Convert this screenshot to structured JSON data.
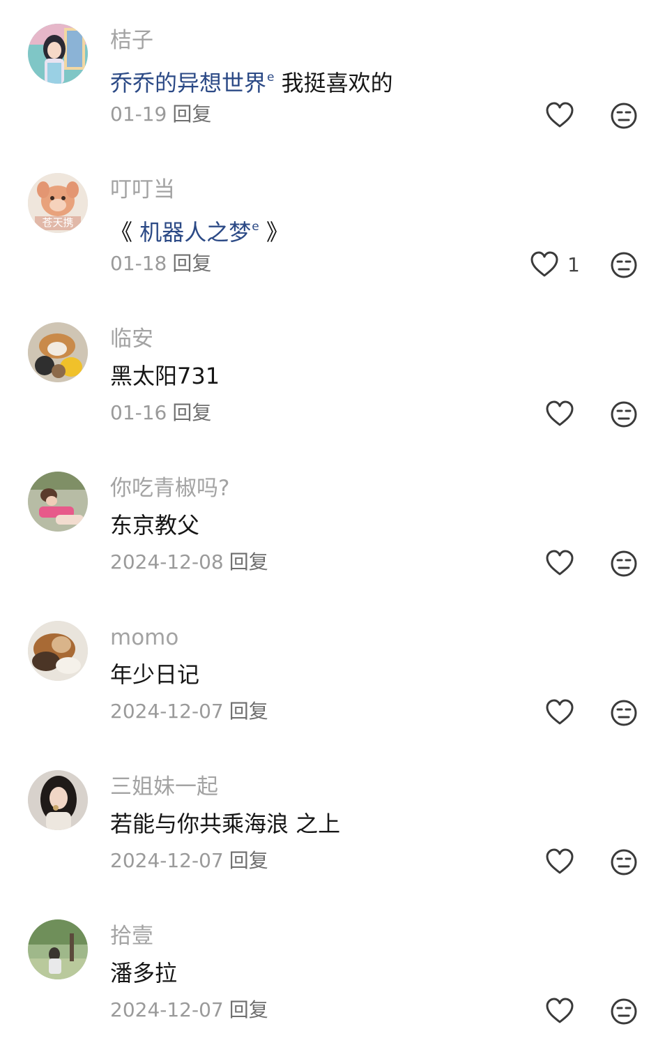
{
  "comments": [
    {
      "username": "桔子",
      "content_link": "乔乔的异想世界",
      "content_text": " 我挺喜欢的",
      "date": "01-19",
      "reply_label": "回复",
      "like_count": "",
      "avatar_kind": "illustrated-girl"
    },
    {
      "username": "叮叮当",
      "content_prefix": "《 ",
      "content_link": "机器人之梦",
      "content_suffix": " 》",
      "date": "01-18",
      "reply_label": "回复",
      "like_count": "1",
      "avatar_text": "苍天携",
      "avatar_kind": "plush-toy"
    },
    {
      "username": "临安",
      "content_text": "黑太阳731",
      "date": "01-16",
      "reply_label": "回复",
      "like_count": "",
      "avatar_kind": "dog-with-toys"
    },
    {
      "username": "你吃青椒吗?",
      "content_text": "东京教父",
      "date": "2024-12-08",
      "reply_label": "回复",
      "like_count": "",
      "avatar_kind": "person-lying"
    },
    {
      "username": "momo",
      "content_text": "年少日记",
      "date": "2024-12-07",
      "reply_label": "回复",
      "like_count": "",
      "avatar_kind": "sleeping-dog"
    },
    {
      "username": "三姐妹一起",
      "content_text": "若能与你共乘海浪 之上",
      "date": "2024-12-07",
      "reply_label": "回复",
      "like_count": "",
      "avatar_kind": "portrait-girl"
    },
    {
      "username": "拾壹",
      "content_text": "潘多拉",
      "date": "2024-12-07",
      "reply_label": "回复",
      "like_count": "",
      "avatar_kind": "park-photo"
    }
  ],
  "icons": {
    "like": "heart-outline-icon",
    "dislike": "neutral-face-icon",
    "link_mark": "search-icon"
  },
  "colors": {
    "username": "#a3a3a3",
    "content": "#161616",
    "link": "#2c4a86",
    "meta": "#9a9a9a",
    "icon": "#3a3a3a"
  }
}
